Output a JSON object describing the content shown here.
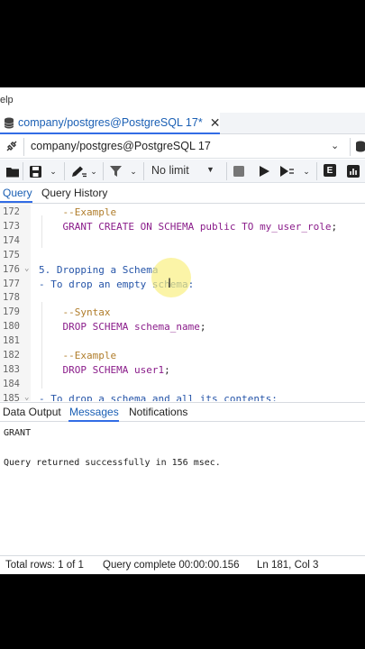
{
  "menu_fragment": "elp",
  "tab": {
    "title": "company/postgres@PostgreSQL 17*",
    "close": "✕"
  },
  "connection": {
    "label": "company/postgres@PostgreSQL 17"
  },
  "toolbar": {
    "limit_label": "No limit",
    "explain_label": "E"
  },
  "query_tabs": [
    "Query",
    "Query History"
  ],
  "editor": {
    "lines": [
      {
        "n": "172",
        "parts": [
          {
            "t": "    --Example",
            "c": "cm"
          }
        ]
      },
      {
        "n": "173",
        "parts": [
          {
            "t": "    GRANT CREATE ON SCHEMA ",
            "c": "kw"
          },
          {
            "t": "public",
            "c": "id"
          },
          {
            "t": " TO ",
            "c": "kw"
          },
          {
            "t": "my_user_role",
            "c": "id"
          },
          {
            "t": ";",
            "c": "pl"
          }
        ]
      },
      {
        "n": "174",
        "parts": []
      },
      {
        "n": "175",
        "parts": []
      },
      {
        "n": "176",
        "fold": "⌄",
        "parts": [
          {
            "t": "5. Dropping a Schema",
            "c": "hd"
          }
        ]
      },
      {
        "n": "177",
        "parts": [
          {
            "t": "- To drop an empty schema:",
            "c": "hd"
          }
        ]
      },
      {
        "n": "178",
        "parts": []
      },
      {
        "n": "179",
        "parts": [
          {
            "t": "    --Syntax",
            "c": "cm"
          }
        ]
      },
      {
        "n": "180",
        "parts": [
          {
            "t": "    DROP SCHEMA ",
            "c": "kw"
          },
          {
            "t": "schema_name",
            "c": "id"
          },
          {
            "t": ";",
            "c": "pl"
          }
        ]
      },
      {
        "n": "181",
        "parts": []
      },
      {
        "n": "182",
        "parts": [
          {
            "t": "    --Example",
            "c": "cm"
          }
        ]
      },
      {
        "n": "183",
        "parts": [
          {
            "t": "    DROP SCHEMA ",
            "c": "kw"
          },
          {
            "t": "user1",
            "c": "id"
          },
          {
            "t": ";",
            "c": "pl"
          }
        ]
      },
      {
        "n": "184",
        "parts": []
      },
      {
        "n": "185",
        "fold": "⌄",
        "parts": [
          {
            "t": "- To drop a schema and all its contents:",
            "c": "hd"
          }
        ]
      }
    ]
  },
  "output_tabs": [
    "Data Output",
    "Messages",
    "Notifications"
  ],
  "messages": [
    "GRANT",
    "Query returned successfully in 156 msec."
  ],
  "status": {
    "total_rows": "Total rows: 1 of 1",
    "query_complete": "Query complete 00:00:00.156",
    "position": "Ln 181, Col 3"
  }
}
